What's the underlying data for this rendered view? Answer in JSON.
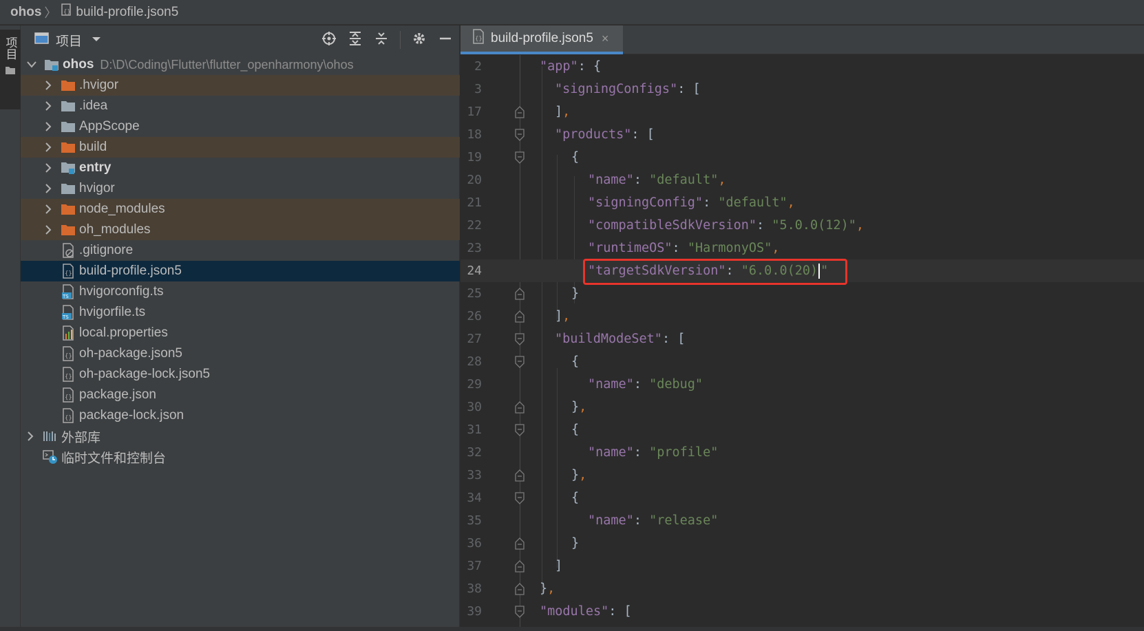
{
  "breadcrumb": {
    "root": "ohos",
    "file": "build-profile.json5"
  },
  "side_strip": {
    "label": "项目"
  },
  "project_panel": {
    "title": "项目",
    "root": {
      "name": "ohos",
      "path": "D:\\D\\Coding\\Flutter\\flutter_openharmony\\ohos"
    },
    "items": [
      {
        "label": ".hvigor"
      },
      {
        "label": ".idea"
      },
      {
        "label": "AppScope"
      },
      {
        "label": "build"
      },
      {
        "label": "entry"
      },
      {
        "label": "hvigor"
      },
      {
        "label": "node_modules"
      },
      {
        "label": "oh_modules"
      },
      {
        "label": ".gitignore"
      },
      {
        "label": "build-profile.json5"
      },
      {
        "label": "hvigorconfig.ts"
      },
      {
        "label": "hvigorfile.ts"
      },
      {
        "label": "local.properties"
      },
      {
        "label": "oh-package.json5"
      },
      {
        "label": "oh-package-lock.json5"
      },
      {
        "label": "package.json"
      },
      {
        "label": "package-lock.json"
      }
    ],
    "external_libs": "外部库",
    "scratches": "临时文件和控制台"
  },
  "editor": {
    "tab_label": "build-profile.json5",
    "tab_close": "×",
    "line_numbers": [
      "2",
      "3",
      "17",
      "18",
      "19",
      "20",
      "21",
      "22",
      "23",
      "24",
      "25",
      "26",
      "27",
      "28",
      "29",
      "30",
      "31",
      "32",
      "33",
      "34",
      "35",
      "36",
      "37",
      "38",
      "39"
    ],
    "current_line": "24"
  },
  "colors": {
    "key": "#9876aa",
    "string": "#6a8759",
    "punct": "#a9b7c6",
    "comma": "#cc7832",
    "selected_row": "#0d293e",
    "excluded_row": "#4a4034",
    "highlight_box": "#e8342b"
  },
  "icons": {
    "folder_orange": "folder-excluded-icon",
    "folder_gray": "folder-icon",
    "module": "module-folder-icon",
    "json": "json-file-icon",
    "ts": "typescript-file-icon",
    "gitignore": "gitignore-file-icon",
    "properties": "properties-file-icon"
  }
}
